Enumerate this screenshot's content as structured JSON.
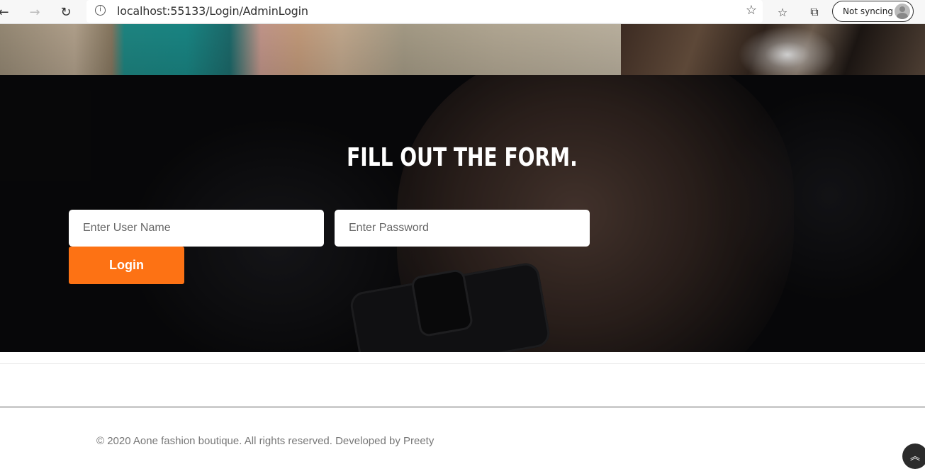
{
  "browser": {
    "back_icon": "arrow-left-icon",
    "forward_icon": "arrow-right-icon",
    "reload_icon": "refresh-icon",
    "info_icon": "info-icon",
    "url": "localhost:55133/Login/AdminLogin",
    "favorite_icon": "star-icon",
    "favorites_list_icon": "favorites-icon",
    "collections_icon": "collections-icon",
    "sync_label": "Not syncing"
  },
  "form": {
    "title": "FILL OUT THE FORM.",
    "username_placeholder": "Enter User Name",
    "password_placeholder": "Enter Password",
    "login_label": "Login",
    "accent_color": "#fd7214"
  },
  "footer": {
    "copyright": "© 2020 Aone fashion boutique. All rights reserved. Developed by Preety",
    "back_to_top_icon": "double-chevron-up-icon"
  }
}
